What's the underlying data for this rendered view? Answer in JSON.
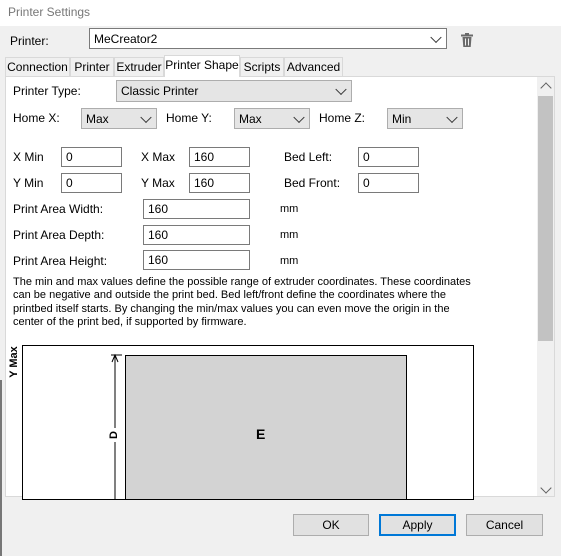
{
  "window": {
    "title": "Printer Settings"
  },
  "printer": {
    "label": "Printer:",
    "selected": "MeCreator2",
    "delete_icon": "trash-icon"
  },
  "tabs": [
    {
      "label": "Connection",
      "active": false
    },
    {
      "label": "Printer",
      "active": false
    },
    {
      "label": "Extruder",
      "active": false
    },
    {
      "label": "Printer Shape",
      "active": true
    },
    {
      "label": "Scripts",
      "active": false
    },
    {
      "label": "Advanced",
      "active": false
    }
  ],
  "shape": {
    "printer_type": {
      "label": "Printer Type:",
      "value": "Classic Printer"
    },
    "home_x": {
      "label": "Home X:",
      "value": "Max"
    },
    "home_y": {
      "label": "Home Y:",
      "value": "Max"
    },
    "home_z": {
      "label": "Home Z:",
      "value": "Min"
    },
    "x_min": {
      "label": "X Min",
      "value": "0"
    },
    "x_max": {
      "label": "X Max",
      "value": "160"
    },
    "bed_left": {
      "label": "Bed Left:",
      "value": "0"
    },
    "y_min": {
      "label": "Y Min",
      "value": "0"
    },
    "y_max": {
      "label": "Y Max",
      "value": "160"
    },
    "bed_front": {
      "label": "Bed Front:",
      "value": "0"
    },
    "area_width": {
      "label": "Print Area Width:",
      "value": "160",
      "unit": "mm"
    },
    "area_depth": {
      "label": "Print Area Depth:",
      "value": "160",
      "unit": "mm"
    },
    "area_height": {
      "label": "Print Area Height:",
      "value": "160",
      "unit": "mm"
    },
    "description": "The min and max values define the possible range of extruder coordinates. These coordinates can be negative and outside the print bed. Bed left/front define the coordinates where the printbed itself starts. By changing the min/max values you can even move the origin in the center of the print bed, if supported by firmware."
  },
  "diagram": {
    "axis_label": "Y Max",
    "dimension_label": "D",
    "bed_label": "E",
    "bed_color": "#d3d3d3"
  },
  "buttons": {
    "ok": "OK",
    "apply": "Apply",
    "cancel": "Cancel"
  },
  "colors": {
    "accent": "#0078d7",
    "panel": "#f0f0f0"
  }
}
